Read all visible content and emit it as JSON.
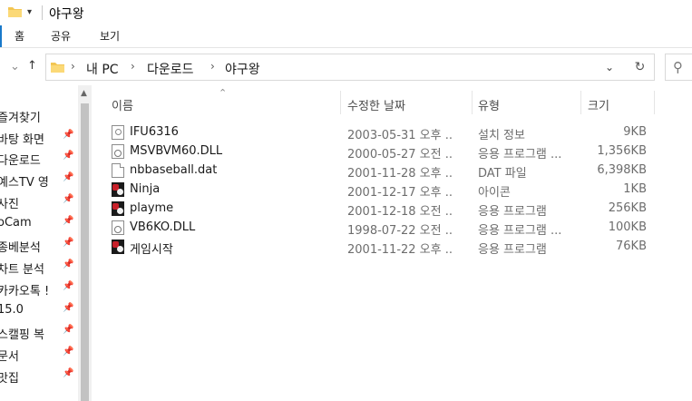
{
  "window": {
    "title": "야구왕"
  },
  "ribbon": {
    "tabs": [
      "홈",
      "공유",
      "보기"
    ]
  },
  "address": {
    "crumbs": [
      "내 PC",
      "다운로드",
      "야구왕"
    ]
  },
  "nav": {
    "items": [
      {
        "label": "즐겨찾기",
        "pinned": false
      },
      {
        "label": "바탕 화면",
        "pinned": true
      },
      {
        "label": "다운로드",
        "pinned": true
      },
      {
        "label": "예스TV 영",
        "pinned": true
      },
      {
        "label": "사진",
        "pinned": true
      },
      {
        "label": "oCam",
        "pinned": true
      },
      {
        "label": "종베분석",
        "pinned": true
      },
      {
        "label": "차트 분석",
        "pinned": true
      },
      {
        "label": "카카오톡 !",
        "pinned": true
      },
      {
        "label": "15.0",
        "pinned": true
      },
      {
        "label": "스캘핑 복",
        "pinned": true
      },
      {
        "label": "문서",
        "pinned": true
      },
      {
        "label": "맛집",
        "pinned": true
      }
    ]
  },
  "columns": {
    "name": "이름",
    "modified": "수정한 날짜",
    "type": "유형",
    "size": "크기"
  },
  "files": [
    {
      "name": "IFU6316",
      "modified": "2003-05-31 오후 ...",
      "type": "설치 정보",
      "size": "9KB",
      "icon": "ini-file-icon"
    },
    {
      "name": "MSVBVM60.DLL",
      "modified": "2000-05-27 오전 ...",
      "type": "응용 프로그램 ...",
      "size": "1,356KB",
      "icon": "dll-file-icon"
    },
    {
      "name": "nbbaseball.dat",
      "modified": "2001-11-28 오후 ...",
      "type": "DAT 파일",
      "size": "6,398KB",
      "icon": "blank-file-icon"
    },
    {
      "name": "Ninja",
      "modified": "2001-12-17 오후 ...",
      "type": "아이콘",
      "size": "1KB",
      "icon": "game-icon"
    },
    {
      "name": "playme",
      "modified": "2001-12-18 오전 ...",
      "type": "응용 프로그램",
      "size": "256KB",
      "icon": "game-icon"
    },
    {
      "name": "VB6KO.DLL",
      "modified": "1998-07-22 오전 ...",
      "type": "응용 프로그램 ...",
      "size": "100KB",
      "icon": "dll-file-icon"
    },
    {
      "name": "게임시작",
      "modified": "2001-11-22 오후 ...",
      "type": "응용 프로그램",
      "size": "76KB",
      "icon": "game-icon"
    }
  ]
}
